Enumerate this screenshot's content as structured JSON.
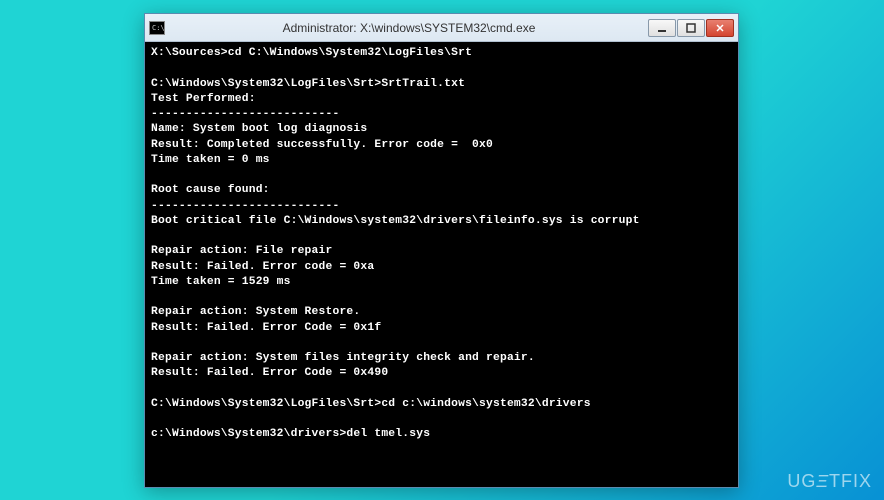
{
  "window": {
    "icon_label": "C:\\",
    "title": "Administrator: X:\\windows\\SYSTEM32\\cmd.exe"
  },
  "terminal": {
    "lines": [
      "X:\\Sources>cd C:\\Windows\\System32\\LogFiles\\Srt",
      "",
      "C:\\Windows\\System32\\LogFiles\\Srt>SrtTrail.txt",
      "Test Performed:",
      "---------------------------",
      "Name: System boot log diagnosis",
      "Result: Completed successfully. Error code =  0x0",
      "Time taken = 0 ms",
      "",
      "Root cause found:",
      "---------------------------",
      "Boot critical file C:\\Windows\\system32\\drivers\\fileinfo.sys is corrupt",
      "",
      "Repair action: File repair",
      "Result: Failed. Error code = 0xa",
      "Time taken = 1529 ms",
      "",
      "Repair action: System Restore.",
      "Result: Failed. Error Code = 0x1f",
      "",
      "Repair action: System files integrity check and repair.",
      "Result: Failed. Error Code = 0x490",
      "",
      "C:\\Windows\\System32\\LogFiles\\Srt>cd c:\\windows\\system32\\drivers",
      "",
      "c:\\Windows\\System32\\drivers>del tmel.sys"
    ]
  },
  "watermark": {
    "text_before": "UG",
    "text_e": "Ξ",
    "text_after": "TFIX"
  }
}
